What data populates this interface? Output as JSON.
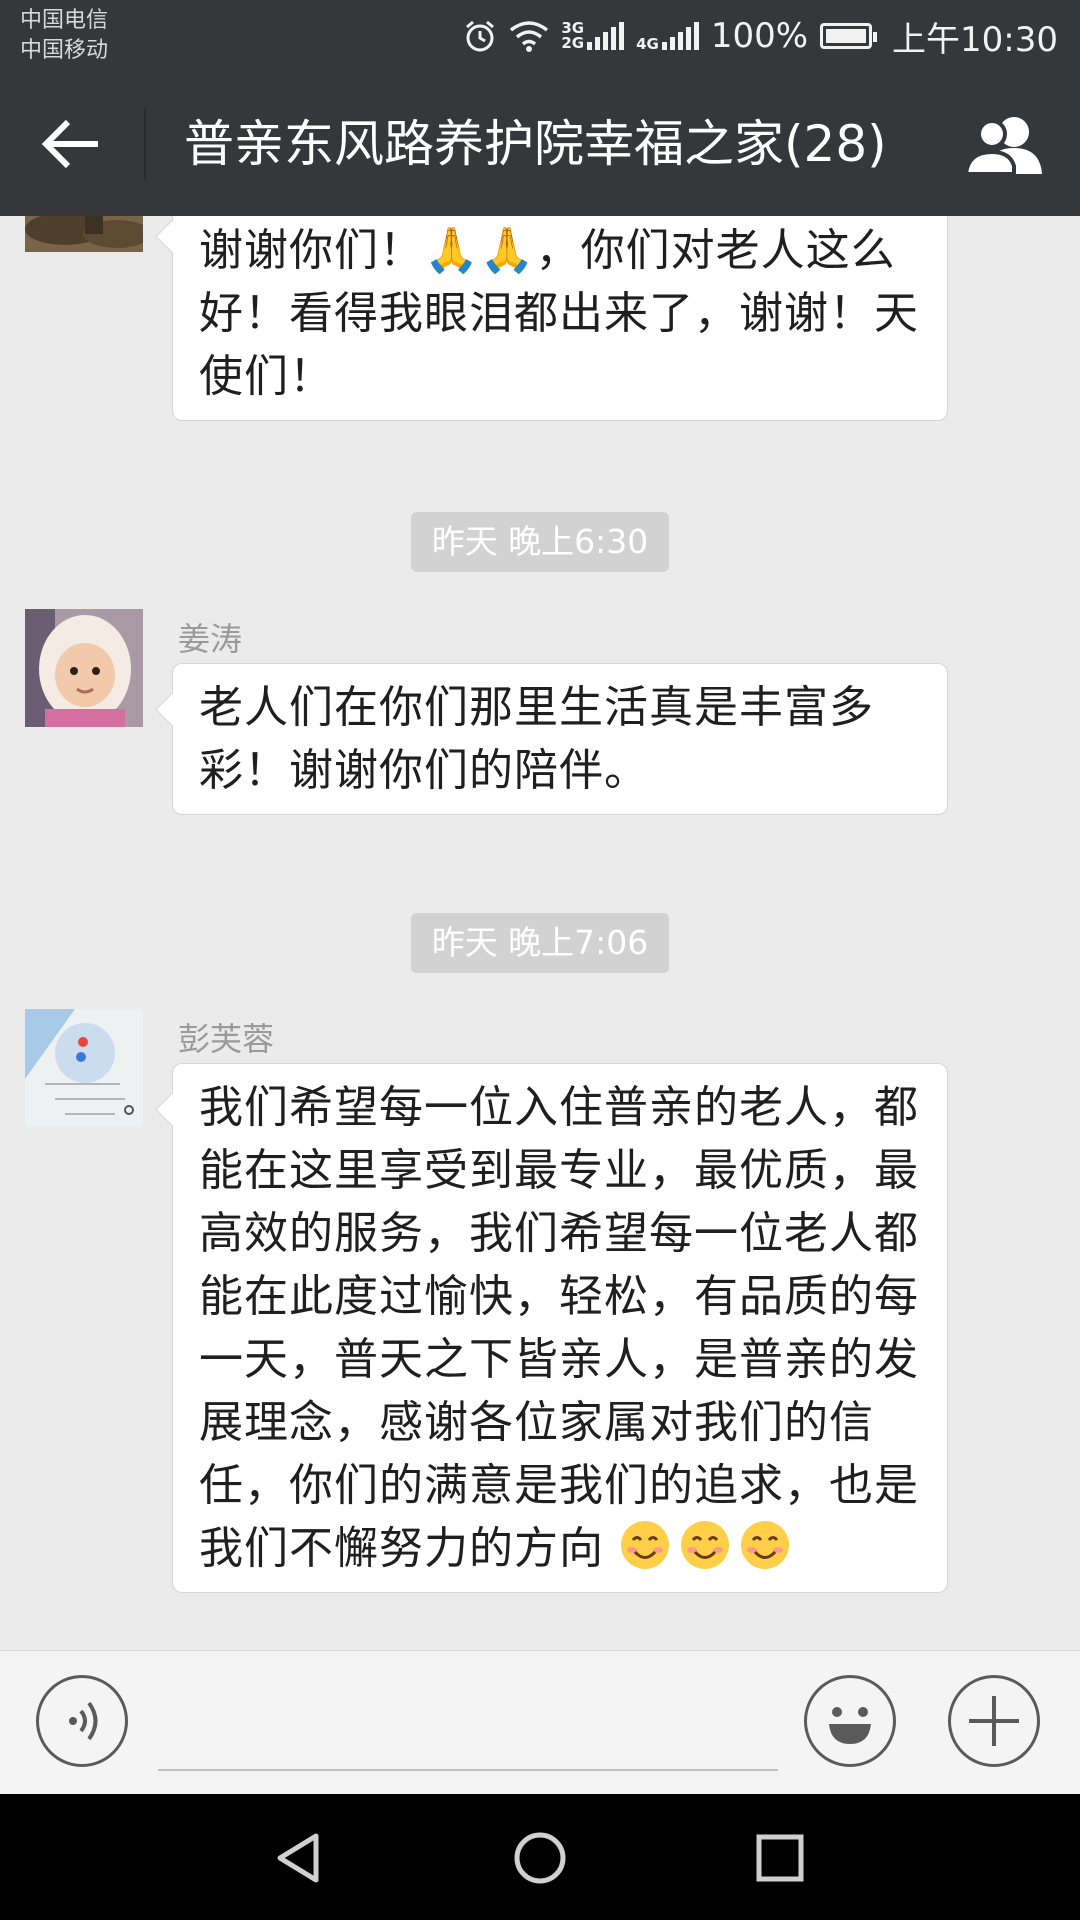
{
  "status_bar": {
    "carrier_1": "中国电信",
    "carrier_2": "中国移动",
    "network_a_top": "3G",
    "network_a_bottom": "2G",
    "network_b": "4G",
    "battery_level": "100%",
    "time": "上午10:30",
    "icons": [
      "alarm-icon",
      "wifi-icon",
      "signal-icon",
      "battery-icon"
    ]
  },
  "header": {
    "title": "普亲东风路养护院幸福之家(28)",
    "back_icon": "back-arrow-icon",
    "members_icon": "group-members-icon"
  },
  "messages": [
    {
      "type": "message",
      "sender": "",
      "text": "谢谢你们！🙏🙏，你们对老人这么好！看得我眼泪都出来了，谢谢！天使们！"
    },
    {
      "type": "timestamp",
      "text": "昨天 晚上6:30"
    },
    {
      "type": "message",
      "sender": "姜涛",
      "text": "老人们在你们那里生活真是丰富多彩！谢谢你们的陪伴。"
    },
    {
      "type": "timestamp",
      "text": "昨天 晚上7:06"
    },
    {
      "type": "message",
      "sender": "彭芙蓉",
      "text": "我们希望每一位入住普亲的老人，都能在这里享受到最专业，最优质，最高效的服务，我们希望每一位老人都能在此度过愉快，轻松，有品质的每一天，普天之下皆亲人，是普亲的发展理念，感谢各位家属对我们的信任，你们的满意是我们的追求，也是我们不懈努力的方向",
      "trailing_emoji": [
        "smiling-face-emoji",
        "smiling-face-emoji",
        "smiling-face-emoji"
      ]
    }
  ],
  "input_bar": {
    "voice_icon": "voice-input-icon",
    "emoji_icon": "emoji-icon",
    "plus_icon": "plus-icon"
  },
  "nav_bar": {
    "buttons": [
      "back-triangle-icon",
      "home-circle-icon",
      "recents-square-icon"
    ]
  },
  "colors": {
    "titlebar": "#35373b",
    "chat_bg": "#ebebeb",
    "bubble": "#ffffff",
    "timestamp_bg": "#d2d2d2"
  }
}
